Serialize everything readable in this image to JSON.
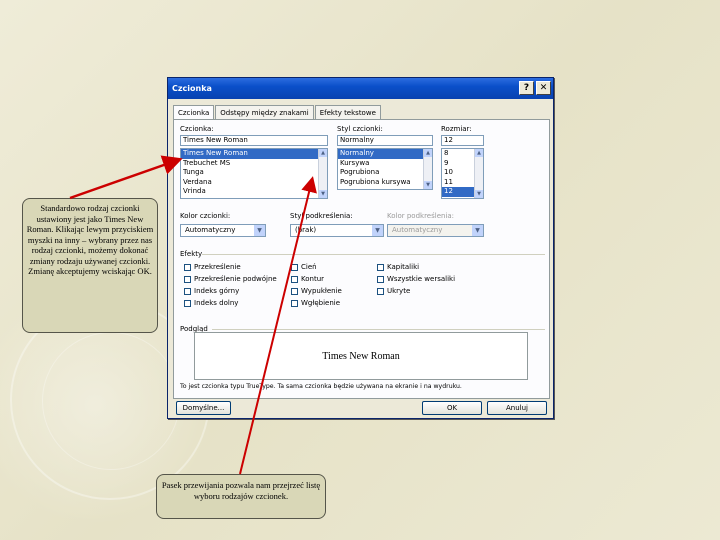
{
  "dialog": {
    "title": "Czcionka",
    "help_button": "?",
    "close_button": "✕",
    "tabs": [
      "Czcionka",
      "Odstępy między znakami",
      "Efekty tekstowe"
    ],
    "font_label": "Czcionka:",
    "font_value": "Times New Roman",
    "font_list": [
      "Times New Roman",
      "Trebuchet MS",
      "Tunga",
      "Verdana",
      "Vrinda"
    ],
    "style_label": "Styl czcionki:",
    "style_value": "Normalny",
    "style_list": [
      "Normalny",
      "Kursywa",
      "Pogrubiona",
      "Pogrubiona kursywa"
    ],
    "size_label": "Rozmiar:",
    "size_value": "12",
    "size_list": [
      "8",
      "9",
      "10",
      "11",
      "12"
    ],
    "color_label": "Kolor czcionki:",
    "color_value": "Automatyczny",
    "underline_label": "Styl podkreślenia:",
    "underline_value": "(brak)",
    "underline_color_label": "Kolor podkreślenia:",
    "underline_color_value": "Automatyczny",
    "effects_label": "Efekty",
    "effects_col1": [
      "Przekreślenie",
      "Przekreślenie podwójne",
      "Indeks górny",
      "Indeks dolny"
    ],
    "effects_col2": [
      "Cień",
      "Kontur",
      "Wypukłenie",
      "Wgłębienie"
    ],
    "effects_col3": [
      "Kapitaliki",
      "Wszystkie wersaliki",
      "Ukryte"
    ],
    "preview_label": "Podgląd",
    "preview_text": "Times New Roman",
    "info_text": "To jest czcionka typu TrueType. Ta sama czcionka będzie używana na ekranie i na wydruku.",
    "default_button": "Domyślne...",
    "ok_button": "OK",
    "cancel_button": "Anuluj"
  },
  "notes": {
    "left": "Standardowo rodzaj czcionki ustawiony jest jako Times New Roman. Klikając lewym przyciskiem myszki na inny – wybrany przez nas rodzaj czcionki, możemy dokonać zmiany rodzaju używanej czcionki. Zmianę akceptujemy wciskając OK.",
    "bottom": "Pasek przewijania pozwala nam przejrzeć listę wyboru rodzajów czcionek."
  },
  "colors": {
    "titlebar": "#0a4fc9",
    "selection": "#316ac5",
    "note_bg": "#d9d7b7",
    "arrow": "#cc0000"
  }
}
